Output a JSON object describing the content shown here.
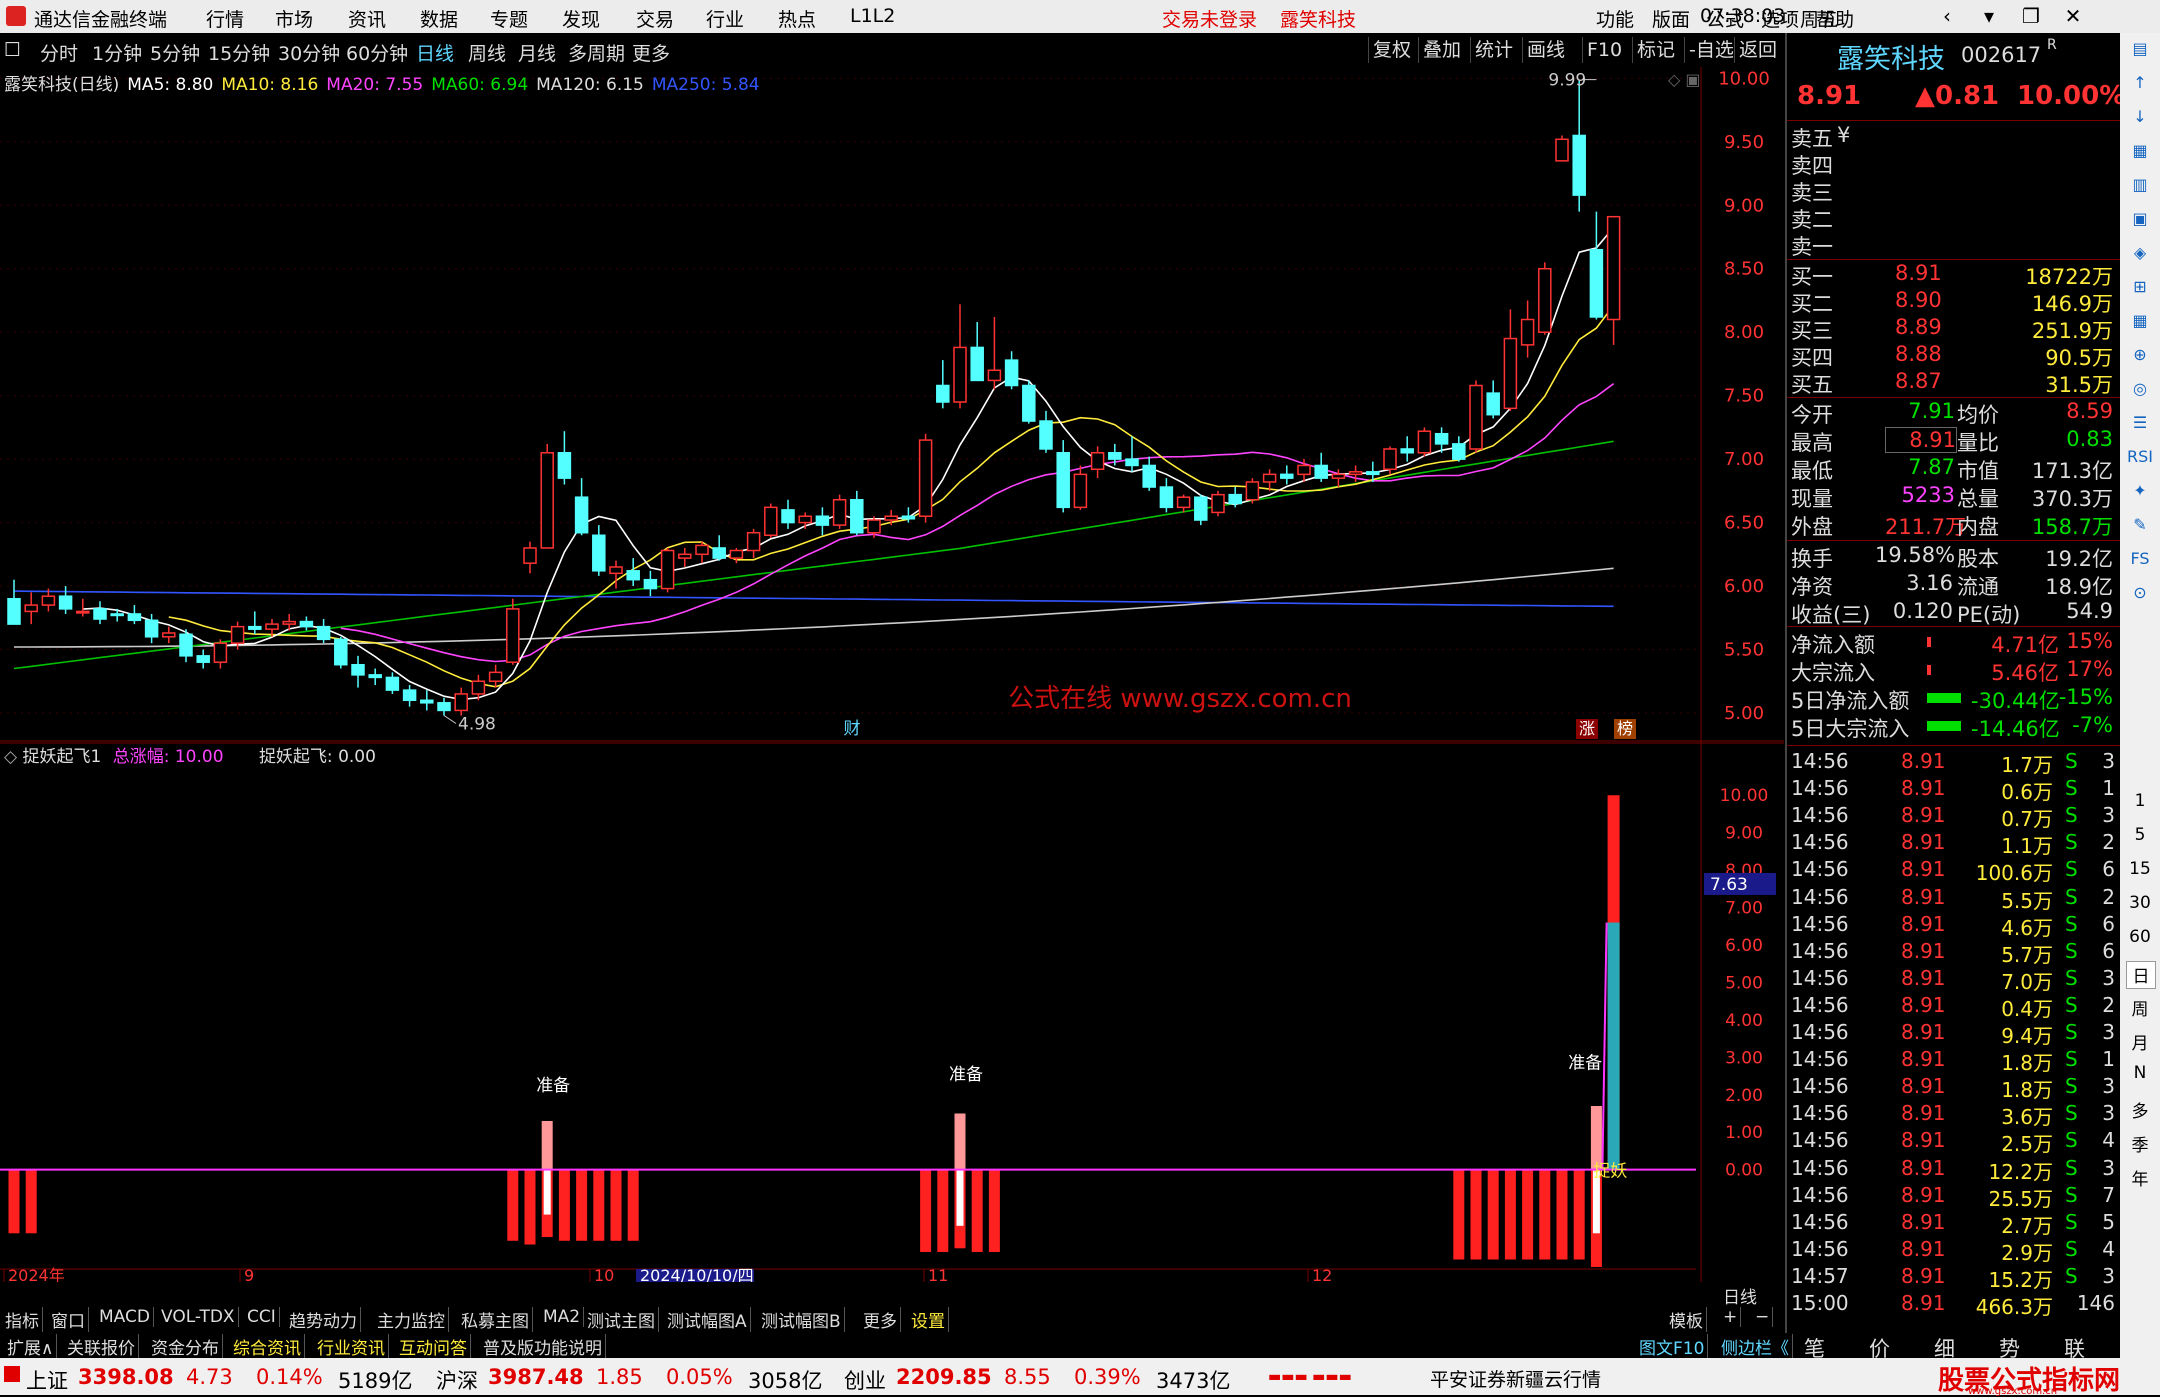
{
  "app": {
    "title": "通达信金融终端",
    "menu": [
      "行情",
      "市场",
      "资讯",
      "数据",
      "专题",
      "发现",
      "交易",
      "行业",
      "热点",
      "L1L2"
    ],
    "trade_status": "交易未登录",
    "stock_name_top": "露笑科技",
    "right_menu": [
      "功能",
      "版面",
      "公式",
      "选项",
      "帮助"
    ],
    "time": "07:38:03",
    "weekday": "周五",
    "win_buttons": [
      "‹",
      "▾",
      "❐",
      "✕"
    ]
  },
  "toolbar": {
    "periods": [
      "分时",
      "1分钟",
      "5分钟",
      "15分钟",
      "30分钟",
      "60分钟",
      "日线",
      "周线",
      "月线",
      "多周期",
      "更多"
    ],
    "selected": "日线",
    "right": [
      "复权",
      "叠加",
      "统计",
      "画线",
      "F10",
      "标记",
      "-自选",
      "返回"
    ]
  },
  "main_legend": {
    "name": "露笑科技(日线)",
    "ma": [
      {
        "label": "MA5: 8.80",
        "color": "#ffffff"
      },
      {
        "label": "MA10: 8.16",
        "color": "#ffeb3b"
      },
      {
        "label": "MA20: 7.55",
        "color": "#ff44ff"
      },
      {
        "label": "MA60: 6.94",
        "color": "#00e000"
      },
      {
        "label": "MA120: 6.15",
        "color": "#dddddd"
      },
      {
        "label": "MA250: 5.84",
        "color": "#3355ff"
      }
    ]
  },
  "chart_data": [
    {
      "type": "candlestick",
      "title": "露笑科技(日线)",
      "y_ticks": [
        "10.00",
        "9.50",
        "9.00",
        "8.50",
        "8.00",
        "7.50",
        "7.00",
        "6.50",
        "6.00",
        "5.50",
        "5.00"
      ],
      "ylim": [
        4.85,
        10.05
      ],
      "annotations": {
        "high": "9.99",
        "low": "4.98"
      },
      "markers": [
        "财",
        "涨",
        "榜"
      ],
      "watermark": "公式在线 www.gszx.com.cn",
      "x_labels": [
        "2024年",
        "9",
        "10",
        "2024/10/10/四",
        "11",
        "12"
      ],
      "ohlc": [
        [
          5.9,
          6.05,
          5.75,
          5.7
        ],
        [
          5.8,
          5.95,
          5.7,
          5.85
        ],
        [
          5.85,
          5.98,
          5.8,
          5.92
        ],
        [
          5.92,
          6.0,
          5.78,
          5.82
        ],
        [
          5.8,
          5.9,
          5.76,
          5.8
        ],
        [
          5.82,
          5.88,
          5.7,
          5.74
        ],
        [
          5.78,
          5.82,
          5.72,
          5.77
        ],
        [
          5.78,
          5.85,
          5.7,
          5.73
        ],
        [
          5.73,
          5.78,
          5.55,
          5.6
        ],
        [
          5.6,
          5.68,
          5.55,
          5.63
        ],
        [
          5.62,
          5.66,
          5.4,
          5.45
        ],
        [
          5.45,
          5.5,
          5.35,
          5.4
        ],
        [
          5.4,
          5.58,
          5.35,
          5.55
        ],
        [
          5.55,
          5.72,
          5.5,
          5.68
        ],
        [
          5.68,
          5.8,
          5.62,
          5.66
        ],
        [
          5.66,
          5.74,
          5.6,
          5.7
        ],
        [
          5.7,
          5.78,
          5.65,
          5.72
        ],
        [
          5.72,
          5.76,
          5.65,
          5.68
        ],
        [
          5.68,
          5.74,
          5.55,
          5.58
        ],
        [
          5.58,
          5.6,
          5.35,
          5.38
        ],
        [
          5.38,
          5.45,
          5.2,
          5.3
        ],
        [
          5.3,
          5.35,
          5.22,
          5.28
        ],
        [
          5.28,
          5.32,
          5.15,
          5.18
        ],
        [
          5.18,
          5.22,
          5.05,
          5.1
        ],
        [
          5.1,
          5.18,
          5.02,
          5.08
        ],
        [
          5.08,
          5.12,
          4.98,
          5.02
        ],
        [
          5.02,
          5.2,
          4.98,
          5.15
        ],
        [
          5.15,
          5.3,
          5.1,
          5.25
        ],
        [
          5.25,
          5.38,
          5.2,
          5.32
        ],
        [
          5.4,
          5.9,
          5.38,
          5.82
        ],
        [
          6.18,
          6.35,
          6.1,
          6.3
        ],
        [
          6.3,
          7.12,
          6.3,
          7.05
        ],
        [
          7.05,
          7.22,
          6.8,
          6.85
        ],
        [
          6.7,
          6.85,
          6.4,
          6.42
        ],
        [
          6.4,
          6.48,
          6.08,
          6.12
        ],
        [
          6.1,
          6.2,
          5.98,
          6.15
        ],
        [
          6.12,
          6.22,
          6.0,
          6.05
        ],
        [
          6.05,
          6.12,
          5.92,
          5.98
        ],
        [
          5.98,
          6.3,
          5.95,
          6.28
        ],
        [
          6.22,
          6.3,
          6.15,
          6.25
        ],
        [
          6.25,
          6.35,
          6.18,
          6.32
        ],
        [
          6.3,
          6.4,
          6.2,
          6.22
        ],
        [
          6.22,
          6.3,
          6.18,
          6.28
        ],
        [
          6.28,
          6.45,
          6.22,
          6.42
        ],
        [
          6.4,
          6.65,
          6.38,
          6.62
        ],
        [
          6.6,
          6.68,
          6.45,
          6.5
        ],
        [
          6.5,
          6.58,
          6.45,
          6.55
        ],
        [
          6.55,
          6.62,
          6.4,
          6.48
        ],
        [
          6.48,
          6.72,
          6.45,
          6.68
        ],
        [
          6.68,
          6.75,
          6.4,
          6.42
        ],
        [
          6.42,
          6.55,
          6.38,
          6.52
        ],
        [
          6.52,
          6.6,
          6.48,
          6.55
        ],
        [
          6.55,
          6.62,
          6.5,
          6.53
        ],
        [
          6.55,
          7.2,
          6.5,
          7.15
        ],
        [
          7.58,
          7.78,
          7.4,
          7.45
        ],
        [
          7.45,
          8.22,
          7.4,
          7.88
        ],
        [
          7.88,
          8.08,
          7.62,
          7.62
        ],
        [
          7.62,
          8.12,
          7.55,
          7.7
        ],
        [
          7.78,
          7.85,
          7.55,
          7.58
        ],
        [
          7.58,
          7.62,
          7.28,
          7.3
        ],
        [
          7.3,
          7.38,
          7.05,
          7.08
        ],
        [
          7.05,
          7.15,
          6.58,
          6.62
        ],
        [
          6.62,
          6.95,
          6.6,
          6.88
        ],
        [
          6.92,
          7.1,
          6.85,
          7.05
        ],
        [
          7.05,
          7.12,
          6.95,
          7.0
        ],
        [
          7.0,
          7.18,
          6.9,
          6.95
        ],
        [
          6.95,
          7.02,
          6.75,
          6.78
        ],
        [
          6.78,
          6.85,
          6.58,
          6.62
        ],
        [
          6.62,
          6.72,
          6.58,
          6.7
        ],
        [
          6.7,
          6.72,
          6.48,
          6.52
        ],
        [
          6.58,
          6.75,
          6.55,
          6.72
        ],
        [
          6.72,
          6.78,
          6.62,
          6.65
        ],
        [
          6.68,
          6.85,
          6.65,
          6.82
        ],
        [
          6.82,
          6.92,
          6.75,
          6.88
        ],
        [
          6.88,
          6.95,
          6.8,
          6.85
        ],
        [
          6.88,
          7.0,
          6.82,
          6.95
        ],
        [
          6.95,
          7.05,
          6.82,
          6.85
        ],
        [
          6.85,
          6.92,
          6.78,
          6.88
        ],
        [
          6.88,
          6.95,
          6.82,
          6.9
        ],
        [
          6.9,
          6.98,
          6.82,
          6.88
        ],
        [
          6.92,
          7.1,
          6.88,
          7.08
        ],
        [
          7.08,
          7.18,
          6.98,
          7.05
        ],
        [
          7.05,
          7.25,
          7.02,
          7.22
        ],
        [
          7.2,
          7.25,
          7.05,
          7.12
        ],
        [
          7.12,
          7.18,
          6.98,
          7.0
        ],
        [
          7.08,
          7.62,
          7.05,
          7.58
        ],
        [
          7.52,
          7.62,
          7.32,
          7.35
        ],
        [
          7.4,
          8.18,
          7.38,
          7.95
        ],
        [
          7.9,
          8.25,
          7.8,
          8.1
        ],
        [
          8.0,
          8.55,
          7.98,
          8.5
        ],
        [
          9.35,
          9.55,
          9.35,
          9.52
        ],
        [
          9.55,
          9.99,
          8.95,
          9.08
        ],
        [
          8.65,
          8.95,
          8.1,
          8.12
        ],
        [
          8.1,
          8.9,
          7.9,
          8.91
        ]
      ]
    },
    {
      "type": "bar",
      "title": "捉妖起飞1",
      "legend": [
        {
          "label": "总涨幅: 10.00",
          "color": "#ff44ff"
        },
        {
          "label": "捉妖起飞: 0.00",
          "color": "#ffffff"
        }
      ],
      "y_ticks": [
        "10.00",
        "9.00",
        "8.00",
        "7.00",
        "6.00",
        "5.00",
        "4.00",
        "3.00",
        "2.00",
        "1.00",
        "0.00"
      ],
      "ylim": [
        -2.6,
        10.3
      ],
      "current_value": "7.63",
      "labels": [
        "准备",
        "准备",
        "准备",
        "捉妖"
      ],
      "bars_negative": [
        {
          "i": 0,
          "v": -1.7
        },
        {
          "i": 1,
          "v": -1.7
        },
        {
          "i": 29,
          "v": -1.9
        },
        {
          "i": 30,
          "v": -2.0
        },
        {
          "i": 31,
          "v": -1.8
        },
        {
          "i": 32,
          "v": -1.9
        },
        {
          "i": 33,
          "v": -1.9
        },
        {
          "i": 34,
          "v": -1.9
        },
        {
          "i": 35,
          "v": -1.9
        },
        {
          "i": 36,
          "v": -1.9
        },
        {
          "i": 53,
          "v": -2.2
        },
        {
          "i": 54,
          "v": -2.2
        },
        {
          "i": 55,
          "v": -2.1
        },
        {
          "i": 56,
          "v": -2.2
        },
        {
          "i": 57,
          "v": -2.2
        },
        {
          "i": 84,
          "v": -2.4
        },
        {
          "i": 85,
          "v": -2.4
        },
        {
          "i": 86,
          "v": -2.4
        },
        {
          "i": 87,
          "v": -2.4
        },
        {
          "i": 88,
          "v": -2.4
        },
        {
          "i": 89,
          "v": -2.4
        },
        {
          "i": 90,
          "v": -2.4
        },
        {
          "i": 91,
          "v": -2.4
        },
        {
          "i": 92,
          "v": -2.6
        }
      ],
      "bars_positive": [
        {
          "i": 31,
          "v": 1.3
        },
        {
          "i": 55,
          "v": 1.5
        },
        {
          "i": 92,
          "v": 1.7
        }
      ],
      "bars_white": [
        {
          "i": 31,
          "v": -1.2
        },
        {
          "i": 55,
          "v": -1.5
        },
        {
          "i": 92,
          "v": -1.7
        }
      ],
      "final_bar": {
        "red": 10.0,
        "cyan": 6.6
      }
    }
  ],
  "right_panel": {
    "name": "露笑科技",
    "code": "002617",
    "suffix": "R",
    "price": "8.91",
    "change": "▲0.81",
    "pct": "10.00%",
    "sell": [
      "卖五",
      "卖四",
      "卖三",
      "卖二",
      "卖一"
    ],
    "yen": "¥",
    "buy": [
      {
        "l": "买一",
        "p": "8.91",
        "v": "18722万"
      },
      {
        "l": "买二",
        "p": "8.90",
        "v": "146.9万"
      },
      {
        "l": "买三",
        "p": "8.89",
        "v": "251.9万"
      },
      {
        "l": "买四",
        "p": "8.88",
        "v": "90.5万"
      },
      {
        "l": "买五",
        "p": "8.87",
        "v": "31.5万"
      }
    ],
    "stats": [
      {
        "l1": "今开",
        "v1": "7.91",
        "c1": "g",
        "l2": "均价",
        "v2": "8.59",
        "c2": "r"
      },
      {
        "l1": "最高",
        "v1": "8.91",
        "c1": "r",
        "l2": "量比",
        "v2": "0.83",
        "c2": "g"
      },
      {
        "l1": "最低",
        "v1": "7.87",
        "c1": "g",
        "l2": "市值",
        "v2": "171.3亿",
        "c2": "w"
      },
      {
        "l1": "现量",
        "v1": "5233",
        "c1": "m",
        "l2": "总量",
        "v2": "370.3万",
        "c2": "w"
      },
      {
        "l1": "外盘",
        "v1": "211.7万",
        "c1": "r",
        "l2": "内盘",
        "v2": "158.7万",
        "c2": "g"
      }
    ],
    "stats2": [
      {
        "l1": "换手",
        "v1": "19.58%",
        "l2": "股本",
        "v2": "19.2亿"
      },
      {
        "l1": "净资",
        "v1": "3.16",
        "l2": "流通",
        "v2": "18.9亿"
      },
      {
        "l1": "收益(三)",
        "v1": "0.120",
        "l2": "PE(动)",
        "v2": "54.9"
      }
    ],
    "flows": [
      {
        "l": "净流入额",
        "v": "4.71亿",
        "p": "15%",
        "c": "r"
      },
      {
        "l": "大宗流入",
        "v": "5.46亿",
        "p": "17%",
        "c": "r"
      },
      {
        "l": "5日净流入额",
        "v": "-30.44亿",
        "p": "-15%",
        "c": "g"
      },
      {
        "l": "5日大宗流入",
        "v": "-14.46亿",
        "p": "-7%",
        "c": "g"
      }
    ],
    "ticks": [
      {
        "t": "14:56",
        "p": "8.91",
        "v": "1.7万",
        "n": "3"
      },
      {
        "t": "14:56",
        "p": "8.91",
        "v": "0.6万",
        "n": "1"
      },
      {
        "t": "14:56",
        "p": "8.91",
        "v": "0.7万",
        "n": "3"
      },
      {
        "t": "14:56",
        "p": "8.91",
        "v": "1.1万",
        "n": "2"
      },
      {
        "t": "14:56",
        "p": "8.91",
        "v": "100.6万",
        "n": "6"
      },
      {
        "t": "14:56",
        "p": "8.91",
        "v": "5.5万",
        "n": "2"
      },
      {
        "t": "14:56",
        "p": "8.91",
        "v": "4.6万",
        "n": "6"
      },
      {
        "t": "14:56",
        "p": "8.91",
        "v": "5.7万",
        "n": "6"
      },
      {
        "t": "14:56",
        "p": "8.91",
        "v": "7.0万",
        "n": "3"
      },
      {
        "t": "14:56",
        "p": "8.91",
        "v": "0.4万",
        "n": "2"
      },
      {
        "t": "14:56",
        "p": "8.91",
        "v": "9.4万",
        "n": "3"
      },
      {
        "t": "14:56",
        "p": "8.91",
        "v": "1.8万",
        "n": "1"
      },
      {
        "t": "14:56",
        "p": "8.91",
        "v": "1.8万",
        "n": "3"
      },
      {
        "t": "14:56",
        "p": "8.91",
        "v": "3.6万",
        "n": "3"
      },
      {
        "t": "14:56",
        "p": "8.91",
        "v": "2.5万",
        "n": "4"
      },
      {
        "t": "14:56",
        "p": "8.91",
        "v": "12.2万",
        "n": "3"
      },
      {
        "t": "14:56",
        "p": "8.91",
        "v": "25.5万",
        "n": "7"
      },
      {
        "t": "14:56",
        "p": "8.91",
        "v": "2.7万",
        "n": "5"
      },
      {
        "t": "14:56",
        "p": "8.91",
        "v": "2.9万",
        "n": "4"
      },
      {
        "t": "14:57",
        "p": "8.91",
        "v": "15.2万",
        "n": "3"
      },
      {
        "t": "15:00",
        "p": "8.91",
        "v": "466.3万",
        "n": "146"
      }
    ],
    "tick_side": "S",
    "bottom": [
      "笔",
      "价",
      "细",
      "势",
      "联"
    ]
  },
  "bottom_tabs": {
    "row1": [
      "指标",
      "窗口",
      "MACD",
      "VOL-TDX",
      "CCI",
      "趋势动力",
      "主力监控",
      "私募主图",
      "MA2",
      "测试主图",
      "测试幅图A",
      "测试幅图B",
      "更多",
      "设置"
    ],
    "row1_selected": "设置",
    "row1_right": [
      "模板",
      "+",
      "−"
    ],
    "period_label": "日线",
    "row2": [
      "扩展∧",
      "关联报价",
      "资金分布",
      "综合资讯",
      "行业资讯",
      "互动问答",
      "普及版功能说明"
    ],
    "row2_right": [
      "图文F10",
      "侧边栏《"
    ]
  },
  "status": {
    "items": [
      {
        "n": "上证",
        "v": "3398.08",
        "c": "4.73",
        "p": "0.14%",
        "a": "5189亿"
      },
      {
        "n": "沪深",
        "v": "3987.48",
        "c": "1.85",
        "p": "0.05%",
        "a": "3058亿"
      },
      {
        "n": "创业",
        "v": "2209.85",
        "c": "8.55",
        "p": "0.39%",
        "a": "3473亿"
      }
    ],
    "broker": "平安证券新疆云行情",
    "brand": "股票公式指标网",
    "brand_url": "www.gszx.com.cn"
  },
  "sidebar_icons": [
    "分时",
    "K线",
    "资讯",
    "F10",
    "龙虎",
    "RSI",
    "设置"
  ],
  "sidebar_periods": [
    "1",
    "5",
    "15",
    "30",
    "60",
    "日",
    "周",
    "月",
    "N",
    "多",
    "季",
    "年"
  ]
}
